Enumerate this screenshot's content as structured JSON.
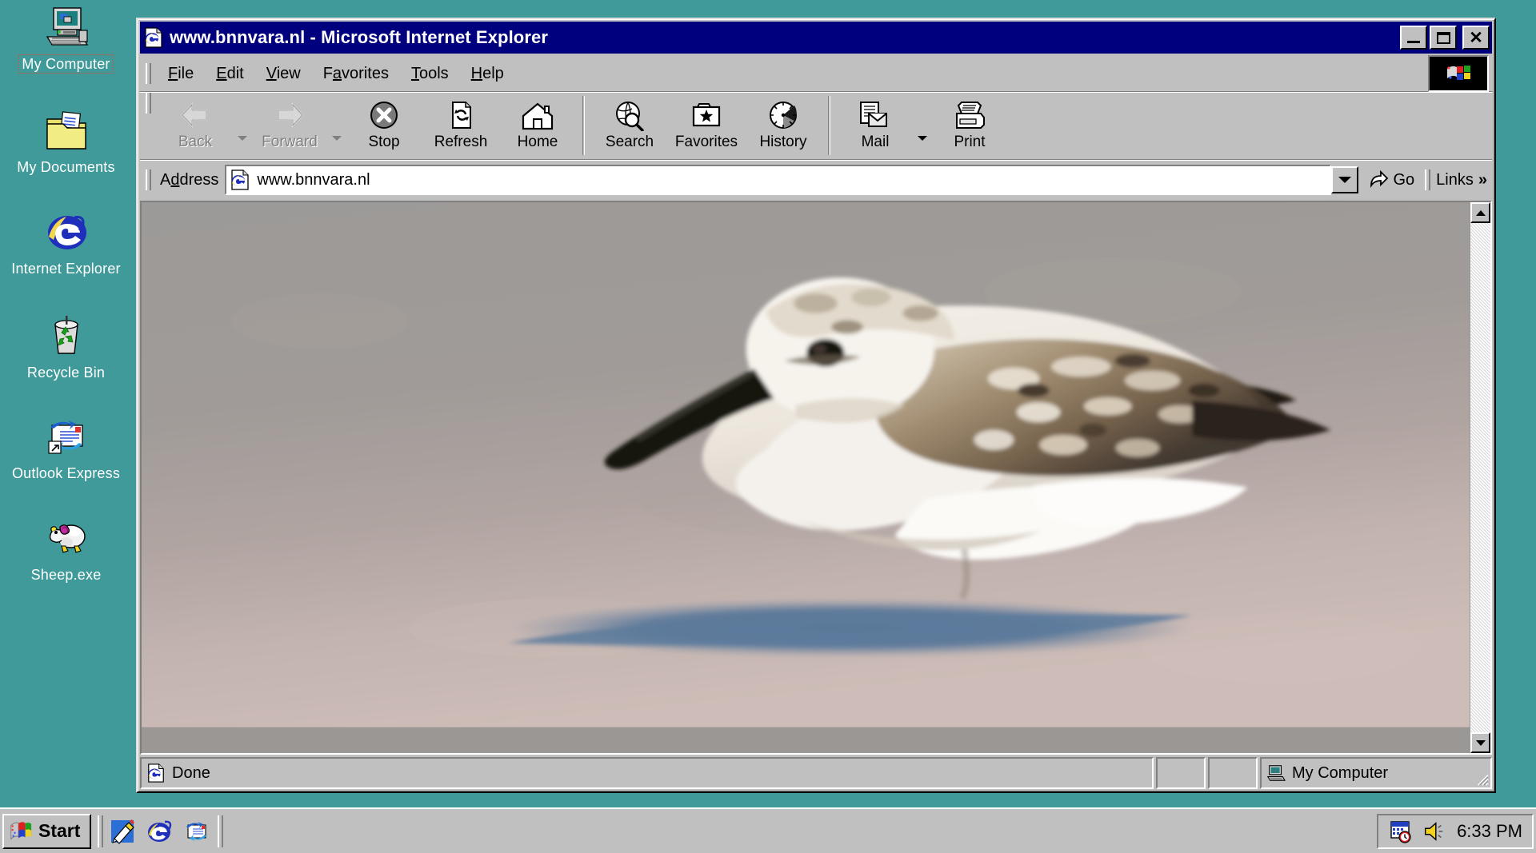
{
  "desktop": {
    "background_color": "#3f9a99",
    "icons": [
      {
        "name": "my-computer",
        "label": "My Computer",
        "icon": "computer-icon",
        "focused": true
      },
      {
        "name": "my-documents",
        "label": "My Documents",
        "icon": "folder-documents-icon",
        "focused": false
      },
      {
        "name": "internet-explorer",
        "label": "Internet Explorer",
        "icon": "ie-e-icon",
        "focused": false
      },
      {
        "name": "recycle-bin",
        "label": "Recycle Bin",
        "icon": "recycle-bin-icon",
        "focused": false
      },
      {
        "name": "outlook-express",
        "label": "Outlook Express",
        "icon": "outlook-express-icon",
        "focused": false
      },
      {
        "name": "sheep-exe",
        "label": "Sheep.exe",
        "icon": "sheep-icon",
        "focused": false
      }
    ]
  },
  "window": {
    "title": "www.bnnvara.nl - Microsoft Internet Explorer",
    "title_icon": "ie-page-icon",
    "title_bar_color": "#00007e",
    "controls": {
      "minimize": "minimize-icon",
      "maximize": "maximize-icon",
      "close": "✕"
    },
    "menus": [
      {
        "label": "File",
        "accel": "F"
      },
      {
        "label": "Edit",
        "accel": "E"
      },
      {
        "label": "View",
        "accel": "V"
      },
      {
        "label": "Favorites",
        "accel": "a"
      },
      {
        "label": "Tools",
        "accel": "T"
      },
      {
        "label": "Help",
        "accel": "H"
      }
    ],
    "toolbar": [
      {
        "label": "Back",
        "icon": "back-arrow-icon",
        "disabled": true,
        "has_dropdown": true
      },
      {
        "label": "Forward",
        "icon": "forward-arrow-icon",
        "disabled": true,
        "has_dropdown": true
      },
      {
        "label": "Stop",
        "icon": "stop-x-icon",
        "disabled": false,
        "has_dropdown": false
      },
      {
        "label": "Refresh",
        "icon": "refresh-page-icon",
        "disabled": false,
        "has_dropdown": false
      },
      {
        "label": "Home",
        "icon": "home-house-icon",
        "disabled": false,
        "has_dropdown": false
      },
      {
        "label": "Search",
        "icon": "search-globe-icon",
        "disabled": false,
        "has_dropdown": false
      },
      {
        "label": "Favorites",
        "icon": "favorites-star-folder-icon",
        "disabled": false,
        "has_dropdown": false
      },
      {
        "label": "History",
        "icon": "history-clock-icon",
        "disabled": false,
        "has_dropdown": false
      },
      {
        "label": "Mail",
        "icon": "mail-envelope-icon",
        "disabled": false,
        "has_dropdown": true
      },
      {
        "label": "Print",
        "icon": "printer-icon",
        "disabled": false,
        "has_dropdown": false
      }
    ],
    "address": {
      "label": "Address",
      "accel": "d",
      "value": "www.bnnvara.nl",
      "placeholder": "",
      "icon": "ie-page-icon",
      "dropdown_icon": "chevron-down-icon"
    },
    "go_button": {
      "label": "Go",
      "icon": "go-arrow-icon"
    },
    "links_button": {
      "label": "Links",
      "icon": "double-chevron-right-icon"
    },
    "animated_logo": "ie-windows-flag-logo",
    "scrollbar": {
      "up": "scroll-up-arrow-icon",
      "down": "scroll-down-arrow-icon"
    },
    "statusbar": {
      "message": "Done",
      "message_icon": "ie-page-icon",
      "zone": "My Computer",
      "zone_icon": "computer-icon"
    },
    "page": {
      "subject": "sanderling shorebird standing on wet sand",
      "background_color": "#9b9794",
      "sand_top_color": "#a39e9b",
      "sand_bottom_color": "#c0b2ae",
      "shadow_color": "#5c7795"
    }
  },
  "taskbar": {
    "start_label": "Start",
    "start_icon": "windows-flag-icon",
    "quicklaunch": [
      {
        "name": "show-desktop",
        "icon": "show-desktop-icon"
      },
      {
        "name": "launch-internet-explorer",
        "icon": "ie-e-icon"
      },
      {
        "name": "launch-outlook-express",
        "icon": "outlook-express-icon"
      }
    ],
    "tray": {
      "icons": [
        {
          "name": "task-scheduler",
          "icon": "task-scheduler-icon"
        },
        {
          "name": "volume",
          "icon": "speaker-volume-icon"
        }
      ],
      "clock": "6:33 PM"
    }
  }
}
